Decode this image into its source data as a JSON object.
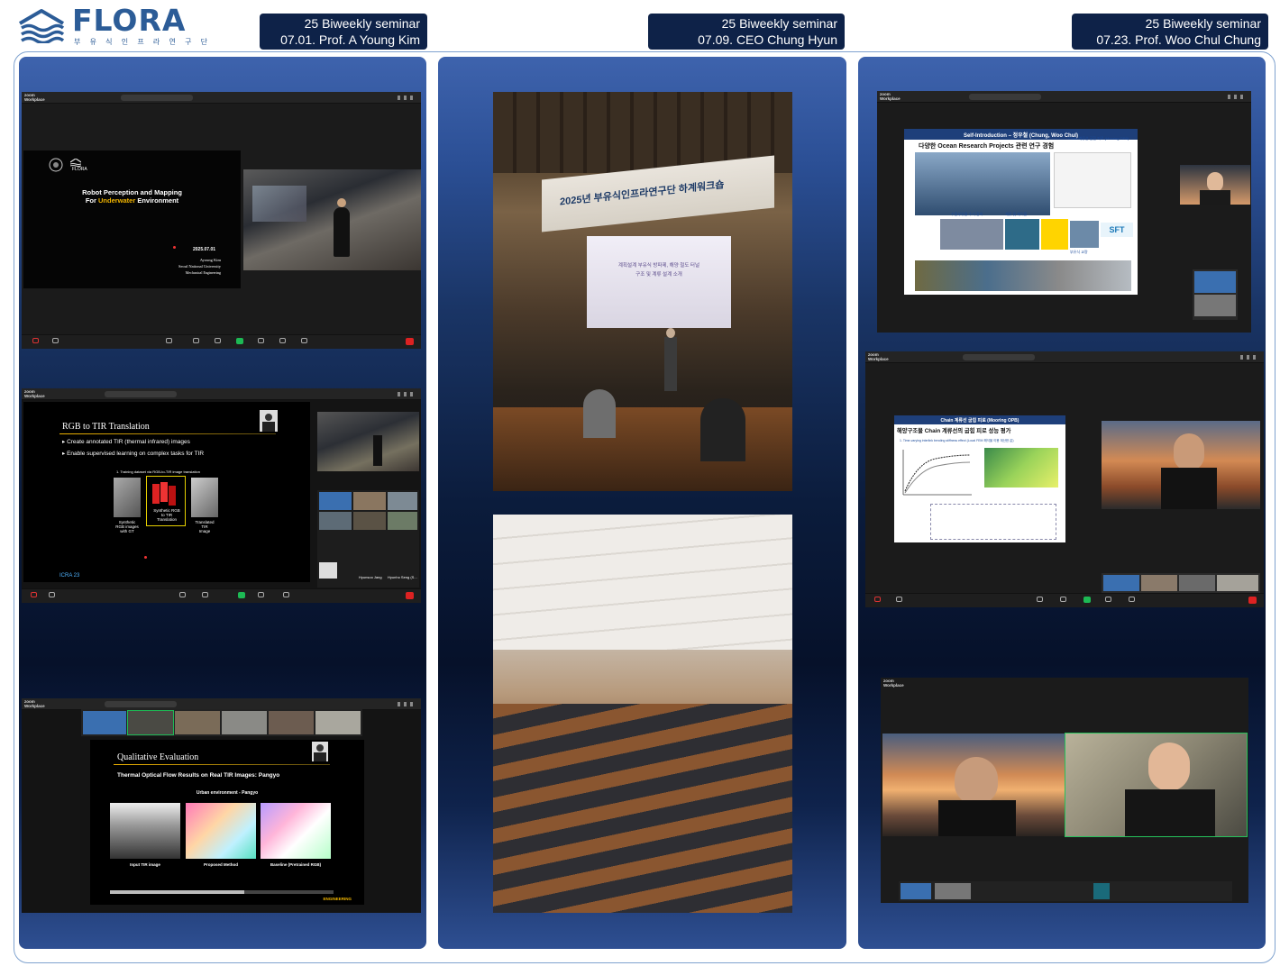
{
  "brand": {
    "logo_text": "FLORA",
    "logo_subtitle": "부 유 식 인 프 라 연 구 단",
    "colors": {
      "brand": "#2c5c97",
      "tag_bg": "#0e2248"
    }
  },
  "seminars": [
    {
      "line1": "25 Biweekly seminar",
      "line2": "07.01. Prof. A Young Kim"
    },
    {
      "line1": "25 Biweekly seminar",
      "line2": "07.09. CEO Chung Hyun"
    },
    {
      "line1": "25 Biweekly seminar",
      "line2": "07.23. Prof. Woo Chul Chung"
    }
  ],
  "zoom": {
    "app_name": "zoom\nWorkplace"
  },
  "kim": {
    "title_slide": {
      "line1": "Robot Perception and Mapping",
      "line2_a": "For ",
      "line2_b": "Underwater",
      "line2_c": " Environment",
      "date": "2025.07.01",
      "presenter": "Ayoung Kim",
      "affiliation": "Seoul National University",
      "dept": "Mechanical Engineering",
      "flora_mark": "FLORA"
    },
    "rgb_slide": {
      "title": "RGB to TIR Translation",
      "bullet1": "Create annotated TIR (thermal infrared) images",
      "bullet2": "Enable supervised learning on complex tasks for TIR",
      "diagram_caption": "1. Training dataset via RGB-to-TIR image translation",
      "label_left": "Synthetic\nRGB images\nwith GT",
      "label_mid": "Synthetic RGB\nto TIR\nTranslation",
      "label_right": "Translated\nTIR\nImage",
      "citation": "ICRA 23",
      "gallery_names": [
        "Hyunsoo Jang",
        "Hyunho Seng (S..."
      ]
    },
    "qual_slide": {
      "title": "Qualitative Evaluation",
      "subtitle": "Thermal Optical Flow Results on Real TIR Images: Pangyo",
      "env": "Urban environment - Pangyo",
      "cap1": "Input TIR image",
      "cap2": "Proposed Method",
      "cap3": "Baseline (Pretrained RGB)",
      "footer": "ENGINEERING"
    }
  },
  "hyun": {
    "banner": "2025년 부유식인프라연구단 하계워크숍",
    "screen_text1": "계획설계 부유식 방파제, 해양 철도 터널",
    "screen_text2": "구조 및 계류 설계 소개"
  },
  "chung": {
    "intro_slide": {
      "title": "Self-Introduction – 정우철 (Chung, Woo Chul)",
      "heading": "다양한 Ocean Research Projects 관련 연구 경험",
      "labels": [
        "Chain 계류선 굽힘 피로 (Mooring OPB)",
        "수중부유물 수거 장비",
        "계류 및 케이블",
        "부유식 교량",
        "SFT"
      ]
    },
    "chain_slide": {
      "header": "Chain 계류선 굽힘 피로 (Mooring OPB)",
      "title": "해양구조물 Chain 계류선의 굽힘 피로 성능 평가",
      "point": "1. Time-varying interlink bending stiffness effect (Local FEM 해석을 이용 계산한 값)"
    }
  }
}
